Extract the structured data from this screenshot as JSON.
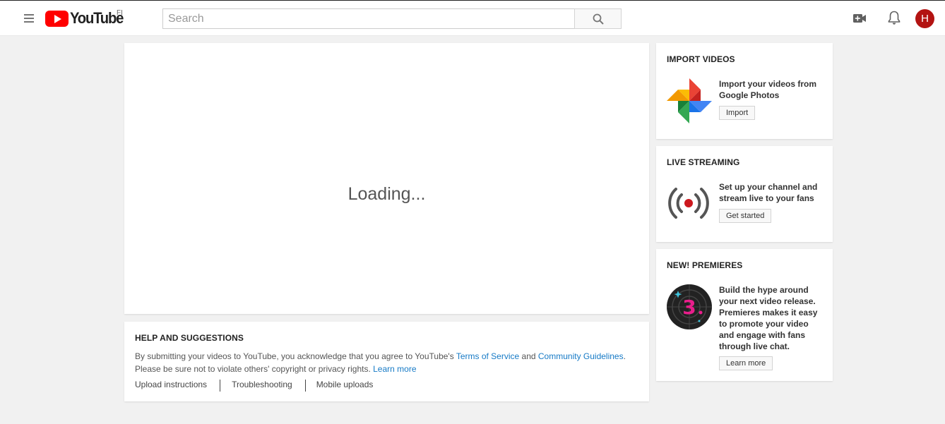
{
  "header": {
    "logo_text": "YouTube",
    "country_code": "FI",
    "search_placeholder": "Search",
    "search_value": "",
    "avatar_letter": "H"
  },
  "main": {
    "loading_text": "Loading..."
  },
  "help": {
    "title": "HELP AND SUGGESTIONS",
    "line1_prefix": "By submitting your videos to YouTube, you acknowledge that you agree to YouTube's ",
    "terms_link": "Terms of Service",
    "and_text": " and ",
    "guidelines_link": "Community Guidelines",
    "line1_suffix": ".",
    "line2": "Please be sure not to violate others' copyright or privacy rights. ",
    "learn_more_link": "Learn more",
    "links": [
      "Upload instructions",
      "Troubleshooting",
      "Mobile uploads"
    ]
  },
  "sidebar": {
    "import": {
      "title": "IMPORT VIDEOS",
      "description": "Import your videos from Google Photos",
      "button": "Import"
    },
    "live": {
      "title": "LIVE STREAMING",
      "description": "Set up your channel and stream live to your fans",
      "button": "Get started"
    },
    "premieres": {
      "title": "NEW! PREMIERES",
      "description": "Build the hype around your next video release. Premieres makes it easy to promote your video and engage with fans through live chat.",
      "button": "Learn more",
      "badge_number": "3"
    }
  },
  "colors": {
    "brand_red": "#ff0000",
    "link_blue": "#167ac6",
    "avatar_bg": "#b31312"
  }
}
